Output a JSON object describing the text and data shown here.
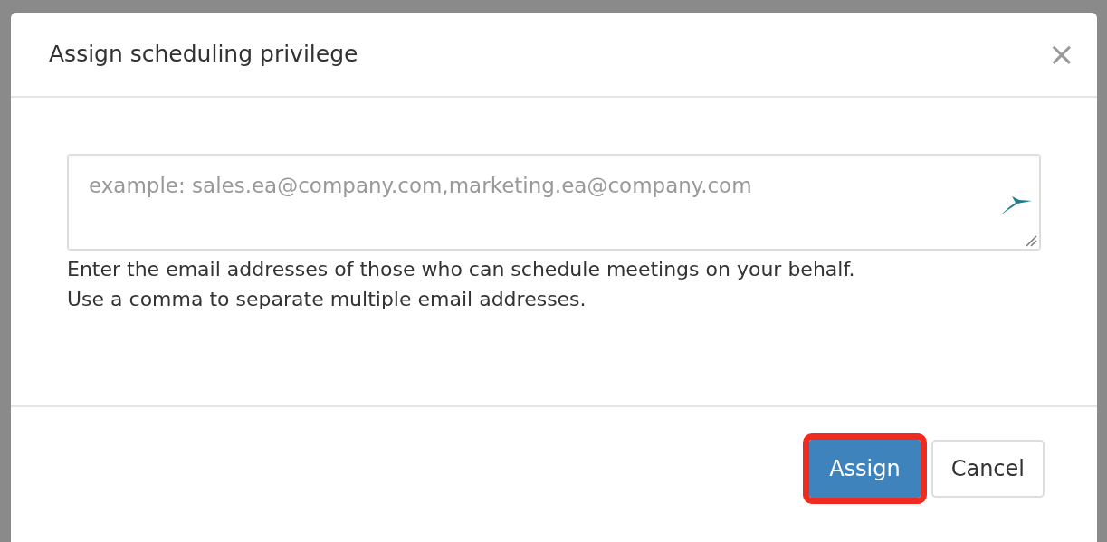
{
  "dialog": {
    "title": "Assign scheduling privilege",
    "close": "×"
  },
  "field": {
    "placeholder": "example: sales.ea@company.com,marketing.ea@company.com"
  },
  "help": [
    "Enter the email addresses of those who can schedule meetings on your behalf.",
    "Use a comma to separate multiple email addresses."
  ],
  "buttons": [
    {
      "label": "Assign",
      "kind": "primary",
      "highlighted": true
    },
    {
      "label": "Cancel",
      "kind": "secondary",
      "highlighted": false
    }
  ]
}
